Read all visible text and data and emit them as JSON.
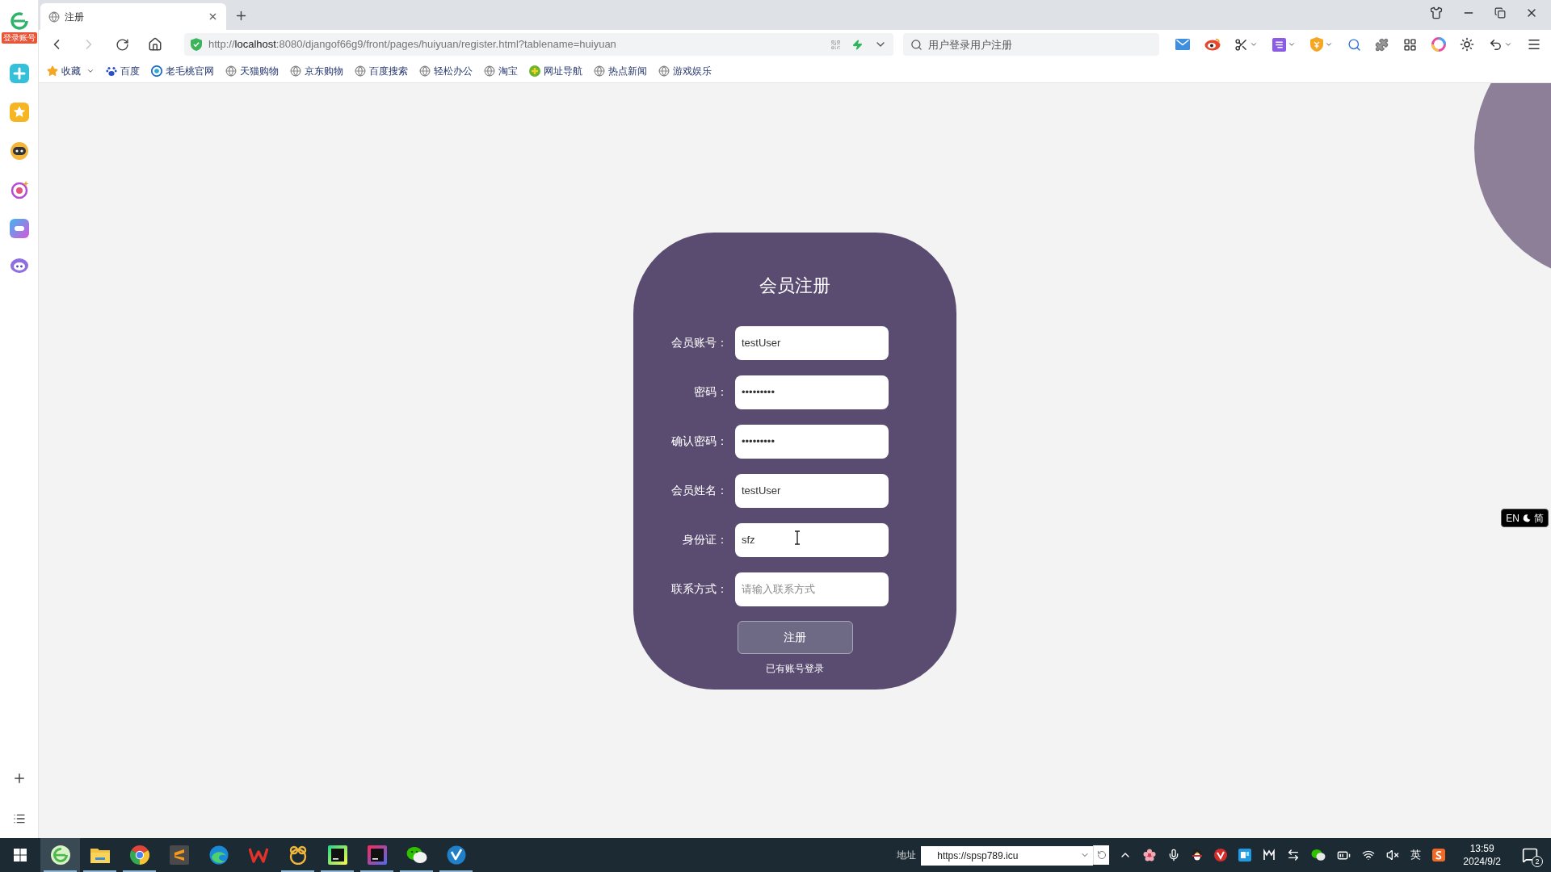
{
  "sidebar": {
    "badge": "登录账号"
  },
  "tabs": [
    {
      "title": "注册",
      "selected": true
    }
  ],
  "navigation": {
    "back_disabled": false,
    "forward_disabled": true
  },
  "address_bar": {
    "url": "http://**localhost**:8080/djangof66g9/front/pages/huiyuan/register.html?tablename=huiyuan"
  },
  "search": {
    "placeholder": "用户登录用户注册"
  },
  "bookmarks": [
    {
      "label": "收藏",
      "kind": "star"
    },
    {
      "label": "百度",
      "kind": "paw"
    },
    {
      "label": "老毛桃官网",
      "kind": "peach"
    },
    {
      "label": "天猫购物",
      "kind": "globe"
    },
    {
      "label": "京东购物",
      "kind": "globe"
    },
    {
      "label": "百度搜索",
      "kind": "globe"
    },
    {
      "label": "轻松办公",
      "kind": "globe"
    },
    {
      "label": "淘宝",
      "kind": "globe"
    },
    {
      "label": "网址导航",
      "kind": "plus"
    },
    {
      "label": "热点新闻",
      "kind": "globe"
    },
    {
      "label": "游戏娱乐",
      "kind": "globe"
    }
  ],
  "form": {
    "title": "会员注册",
    "fields": [
      {
        "label": "会员账号：",
        "value": "testUser"
      },
      {
        "label": "密码：",
        "value": "•••••••••"
      },
      {
        "label": "确认密码：",
        "value": "•••••••••"
      },
      {
        "label": "会员姓名：",
        "value": "testUser"
      },
      {
        "label": "身份证：",
        "value": "sfz"
      },
      {
        "label": "联系方式：",
        "placeholder": "请输入联系方式"
      }
    ],
    "submit": "注册",
    "login_link": "已有账号登录"
  },
  "ime_float": {
    "mode": "EN",
    "script": "简"
  },
  "taskbar": {
    "apps": [
      {
        "kind": "ring",
        "selected": true,
        "running": true
      },
      {
        "kind": "folder",
        "selected": false,
        "running": true
      },
      {
        "kind": "tricolor",
        "selected": false,
        "running": true
      },
      {
        "kind": "tile",
        "selected": false,
        "running": false
      },
      {
        "kind": "swirl",
        "selected": false,
        "running": false
      },
      {
        "kind": "zigzag",
        "selected": false,
        "running": false
      },
      {
        "kind": "rings",
        "selected": false,
        "running": true
      },
      {
        "kind": "green-square",
        "selected": false,
        "running": true
      },
      {
        "kind": "pink-square",
        "selected": false,
        "running": true
      },
      {
        "kind": "bubbles",
        "selected": false,
        "running": true
      },
      {
        "kind": "vcheck",
        "selected": false,
        "running": true
      }
    ]
  },
  "address": {
    "label": "地址",
    "value": "https://spsp789.icu"
  },
  "tray": {
    "ime": "英",
    "time": "13:59",
    "date": "2024/9/2",
    "notifications": "2"
  }
}
